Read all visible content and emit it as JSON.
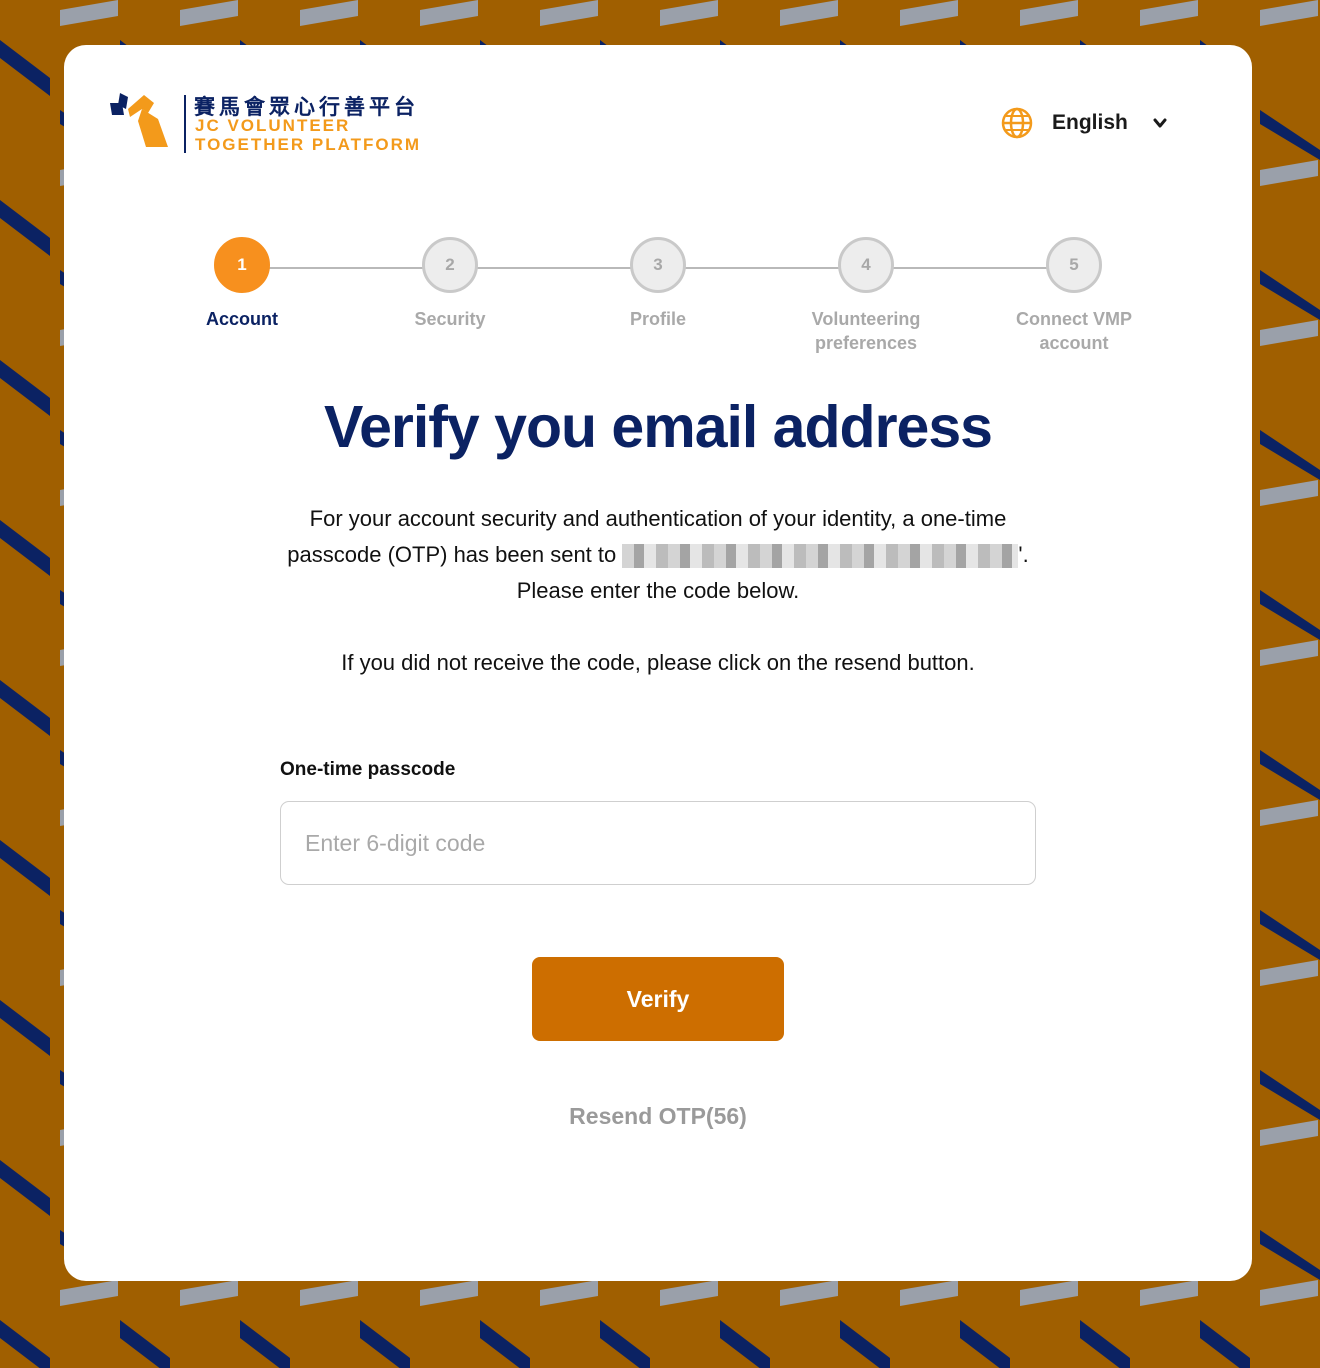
{
  "brand": {
    "name_zh": "賽馬會眾心行善平台",
    "name_en_line1": "JC VOLUNTEER",
    "name_en_line2": "TOGETHER PLATFORM"
  },
  "language_selector": {
    "icon": "globe-icon",
    "label": "English",
    "chevron": "chevron-down-icon"
  },
  "steps": [
    {
      "number": "1",
      "label": "Account",
      "state": "active"
    },
    {
      "number": "2",
      "label": "Security",
      "state": "inactive"
    },
    {
      "number": "3",
      "label": "Profile",
      "state": "inactive"
    },
    {
      "number": "4",
      "label": "Volunteering preferences",
      "state": "inactive"
    },
    {
      "number": "5",
      "label": "Connect VMP account",
      "state": "inactive"
    }
  ],
  "main": {
    "title": "Verify you email address",
    "description_before": "For your account security and authentication of your identity, a one-time passcode (OTP) has been sent to ",
    "description_after": "'. Please enter the code below.",
    "description_2": "If you did not receive the code, please click on the resend button.",
    "otp_label": "One-time passcode",
    "otp_placeholder": "Enter 6-digit code",
    "otp_value": "",
    "verify_label": "Verify",
    "resend_label": "Resend OTP(56)"
  },
  "colors": {
    "navy": "#0b2263",
    "orange": "#f7901e",
    "button": "#cd6e00",
    "background": "#a05f00"
  }
}
